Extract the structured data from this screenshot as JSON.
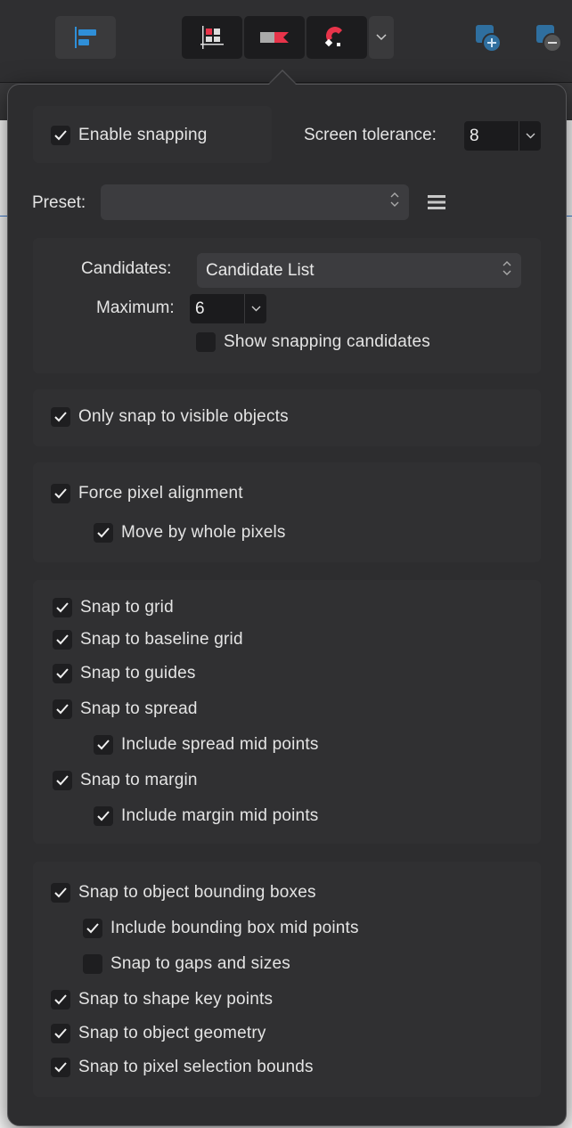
{
  "toolbar": {
    "icons": [
      "align-left-icon",
      "snap-grid-icon",
      "snap-toggle-icon",
      "magnet-help-icon",
      "chevron-down-icon",
      "add-shape-icon",
      "remove-shape-icon"
    ]
  },
  "snapping": {
    "enable_label": "Enable snapping",
    "enable_checked": true,
    "tolerance_label": "Screen tolerance:",
    "tolerance_value": "8",
    "preset_label": "Preset:",
    "preset_value": "",
    "candidates_label": "Candidates:",
    "candidates_value": "Candidate List",
    "maximum_label": "Maximum:",
    "maximum_value": "6",
    "show_candidates_label": "Show snapping candidates",
    "show_candidates_checked": false,
    "visible_only_label": "Only snap to visible objects",
    "force_pixel_label": "Force pixel alignment",
    "whole_pixels_label": "Move by whole pixels",
    "grid_options": [
      {
        "label": "Snap to grid",
        "checked": true
      },
      {
        "label": "Snap to baseline grid",
        "checked": true
      },
      {
        "label": "Snap to guides",
        "checked": true
      },
      {
        "label": "Snap to spread",
        "checked": true
      },
      {
        "label": "Include spread mid points",
        "checked": true
      },
      {
        "label": "Snap to margin",
        "checked": true
      },
      {
        "label": "Include margin mid points",
        "checked": true
      }
    ],
    "object_options": [
      {
        "label": "Snap to object bounding boxes",
        "checked": true
      },
      {
        "label": "Include bounding box mid points",
        "checked": true
      },
      {
        "label": "Snap to gaps and sizes",
        "checked": false
      },
      {
        "label": "Snap to shape key points",
        "checked": true
      },
      {
        "label": "Snap to object geometry",
        "checked": true
      },
      {
        "label": "Snap to pixel selection bounds",
        "checked": true
      }
    ]
  },
  "colors": {
    "accent_red": "#e8344a",
    "accent_blue": "#2f8fd8",
    "panel": "#2d2d2f"
  }
}
